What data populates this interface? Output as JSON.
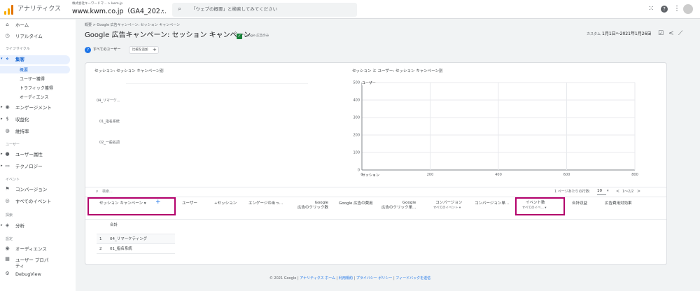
{
  "header": {
    "app_name": "アナリティクス",
    "account_path": "株式会社キーワードマ...  > kwm.jp",
    "property_name": "www.kwm.co.jp（GA4_202...",
    "search_placeholder": "「ウェブの概要」と検索してみてください"
  },
  "sidebar": {
    "items": [
      {
        "icon": "⌂",
        "label": "ホーム"
      },
      {
        "icon": "◷",
        "label": "リアルタイム"
      }
    ],
    "section_lifecycle": "ライフサイクル",
    "acquisition": {
      "icon": "⋄",
      "label": "集客"
    },
    "acquisition_sub": [
      "概要",
      "ユーザー獲得",
      "トラフィック獲得",
      "オーディエンス"
    ],
    "lifecycle_items": [
      {
        "icon": "◉",
        "label": "エンゲージメント"
      },
      {
        "icon": "$",
        "label": "収益化"
      },
      {
        "icon": "◍",
        "label": "維持率"
      }
    ],
    "section_user": "ユーザー",
    "user_items": [
      {
        "icon": "●",
        "label": "ユーザー属性"
      },
      {
        "icon": "▭",
        "label": "テクノロジー"
      }
    ],
    "section_event": "イベント",
    "event_items": [
      {
        "icon": "⚑",
        "label": "コンバージョン"
      },
      {
        "icon": "◎",
        "label": "すべてのイベント"
      }
    ],
    "section_explore": "探索",
    "explore_items": [
      {
        "icon": "◈",
        "label": "分析"
      }
    ],
    "section_config": "設定",
    "config_items": [
      {
        "icon": "◉",
        "label": "オーディエンス"
      },
      {
        "icon": "▦",
        "label": "ユーザー プロパティ"
      },
      {
        "icon": "⚙",
        "label": "DebugView"
      }
    ]
  },
  "page": {
    "breadcrumb_1": "概要",
    "breadcrumb_2": "Google 広告キャンペーン: セッション キャンペーン",
    "title": "Google 広告キャンペーン: セッション キャンペーン",
    "title_badge": "Google 広告のみ",
    "date_label": "カスタム",
    "date_range": "1月1日～2021年1月26日",
    "filter_chip": "すべてのユーザー",
    "compare_button": "比較を追加"
  },
  "charts": {
    "left_title": "セッション: セッション キャンペーン別",
    "left_labels": [
      "04_リマーケ...",
      "01_指名系統",
      "02_一般名詞"
    ],
    "right_title": "セッション と ユーザー: セッション キャンペーン別",
    "right_y_label": "ユーザー",
    "right_x_label": "セッション"
  },
  "chart_data": {
    "type": "scatter",
    "title": "セッション と ユーザー: セッション キャンペーン別",
    "xlabel": "セッション",
    "ylabel": "ユーザー",
    "xlim": [
      0,
      800
    ],
    "ylim": [
      0,
      500
    ],
    "x_ticks": [
      "0",
      "200",
      "400",
      "600",
      "800"
    ],
    "y_ticks": [
      "0",
      "100",
      "200",
      "300",
      "400",
      "500"
    ],
    "grid": true,
    "series": []
  },
  "table": {
    "search_placeholder": "検索...",
    "rows_per_page_label": "1 ページあたりの行数:",
    "rows_per_page": "10",
    "pagination": "1～2/2",
    "dimension_header": "セッション キャンペーン",
    "add_dim": "+",
    "columns": [
      {
        "label": "ユーザー",
        "sub": ""
      },
      {
        "label": "+セッション",
        "sub": ""
      },
      {
        "label": "エンゲージのあっ...",
        "sub": ""
      },
      {
        "label": "Google\n広告のクリック数",
        "sub": ""
      },
      {
        "label": "Google 広告の費用",
        "sub": ""
      },
      {
        "label": "Google\n広告のクリック単...",
        "sub": ""
      },
      {
        "label": "コンバージョン",
        "sub": "すべてのイベント ▾"
      },
      {
        "label": "コンバージョン単...",
        "sub": ""
      },
      {
        "label": "イベント数",
        "sub": "すべてのイベ... ▾"
      },
      {
        "label": "合計収益",
        "sub": ""
      },
      {
        "label": "広告費用対効果",
        "sub": ""
      }
    ],
    "total_label": "合計",
    "rows": [
      {
        "n": "1",
        "name": "04_リマーケティング"
      },
      {
        "n": "2",
        "name": "01_指名系統"
      }
    ]
  },
  "footer": {
    "copyright": "© 2021 Google",
    "links": [
      "アナリティクス ホーム",
      "利用規約",
      "プライバシー ポリシー",
      "フィードバックを送信"
    ]
  },
  "colors": {
    "accent": "#1a73e8",
    "highlight": "#b3006b",
    "logo": "#f9ab00"
  }
}
